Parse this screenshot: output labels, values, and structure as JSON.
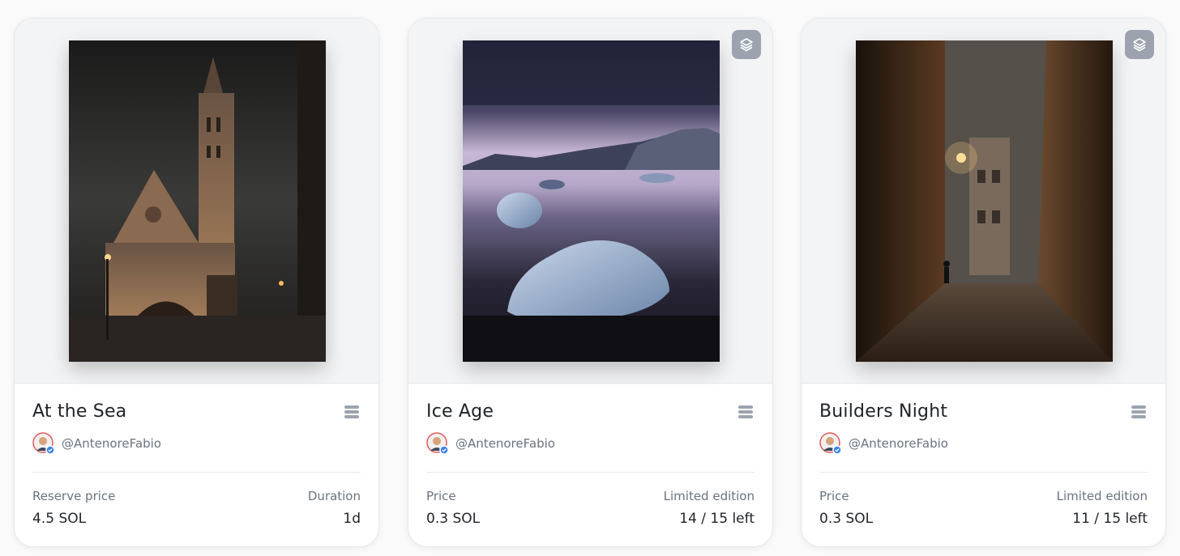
{
  "cards": [
    {
      "title": "At the Sea",
      "creator": "@AntenoreFabio",
      "has_edition_badge": false,
      "left_label": "Reserve price",
      "left_value": "4.5 SOL",
      "right_label": "Duration",
      "right_value": "1d"
    },
    {
      "title": "Ice Age",
      "creator": "@AntenoreFabio",
      "has_edition_badge": true,
      "left_label": "Price",
      "left_value": "0.3 SOL",
      "right_label": "Limited edition",
      "right_value": "14 / 15 left"
    },
    {
      "title": "Builders Night",
      "creator": "@AntenoreFabio",
      "has_edition_badge": true,
      "left_label": "Price",
      "left_value": "0.3 SOL",
      "right_label": "Limited edition",
      "right_value": "11 / 15 left"
    }
  ],
  "icons": {
    "edition_badge": "layers-icon",
    "menu": "menu-icon",
    "verified": "verified-check-icon"
  },
  "colors": {
    "card_bg": "#ffffff",
    "media_bg": "#f3f4f6",
    "badge_bg": "#9ca3af",
    "muted_text": "#6b7280",
    "verified": "#3b82f6"
  }
}
